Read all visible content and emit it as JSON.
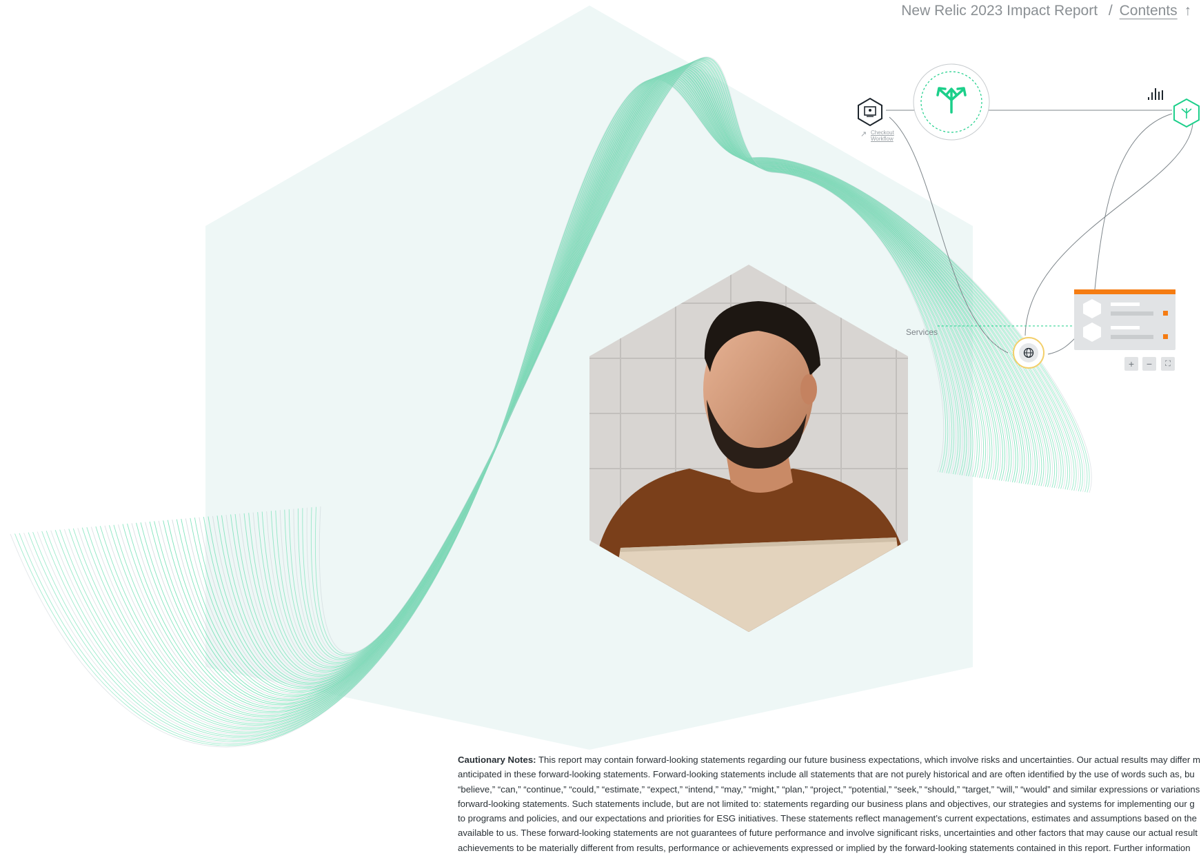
{
  "header": {
    "report_title": "New Relic 2023 Impact Report",
    "separator": "/",
    "contents_link": "Contents",
    "up_arrow": "↑"
  },
  "diagram": {
    "checkout_label_line1": "Checkout",
    "checkout_label_line2": "Workflow",
    "services_label": "Services",
    "controls": {
      "zoom_in": "+",
      "zoom_out": "−",
      "fit": "⛶"
    },
    "icons": [
      "monitor-icon",
      "branch-arrows-icon",
      "signal-bars-icon",
      "hex-branch-icon",
      "globe-icon"
    ]
  },
  "colors": {
    "mint_bg": "#eef7f6",
    "green_accent": "#1ccf8a",
    "orange_accent": "#f57c12",
    "gold_ring": "#f3cf6a"
  },
  "cautionary": {
    "lead": "Cautionary Notes:",
    "lines": [
      " This report may contain forward-looking statements regarding our future business expectations, which involve risks and uncertainties. Our actual results may differ m",
      "anticipated in these forward-looking statements. Forward-looking statements include all statements that are not purely historical and are often identified by the use of words such as, bu",
      "“believe,” “can,” “continue,” “could,” “estimate,” “expect,” “intend,” “may,” “might,” “plan,” “project,” “potential,” “seek,” “should,” “target,” “will,” “would” and similar expressions or variations in",
      "forward-looking statements. Such statements include, but are not limited to: statements regarding our business plans and objectives, our strategies and systems for implementing our g",
      "to programs and policies, and our expectations and priorities for ESG initiatives. These statements reflect management’s current expectations, estimates and assumptions based on the",
      "available to us. These forward-looking statements are not guarantees of future performance and involve significant risks, uncertainties and other factors that may cause our actual result",
      "achievements to be materially different from results, performance or achievements expressed or implied by the forward-looking statements contained in this report. Further information"
    ]
  }
}
